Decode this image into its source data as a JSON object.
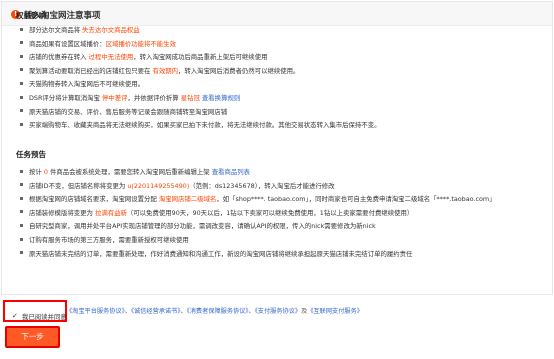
{
  "header": {
    "title": "转入淘宝网注意事项"
  },
  "sections": [
    {
      "title": "权益影响",
      "rows": [
        [
          {
            "t": "部分达尔文商品将 "
          },
          {
            "t": "失去达尔文商品权益",
            "c": "red"
          }
        ],
        [
          {
            "t": "商品如果有设置区域播价："
          },
          {
            "t": "区域播价功能将不能生效",
            "c": "red"
          }
        ],
        [
          {
            "t": "店铺的优惠券在转入 "
          },
          {
            "t": "过程中无法使用",
            "c": "red"
          },
          {
            "t": "，转入淘宝网成功后商品重新上架后可继续使用"
          }
        ],
        [
          {
            "t": "聚划算活动要取消已经出的店铺红包只要在 "
          },
          {
            "t": "有效期内",
            "c": "red"
          },
          {
            "t": "，转入淘宝网后消费者仍然可以继续使用。"
          }
        ],
        [
          {
            "t": "天猫购物券转入淘宝网后不可继续使用。"
          }
        ],
        [
          {
            "t": "DSR评分将计算取消淘宝 "
          },
          {
            "t": "停中差评",
            "c": "red"
          },
          {
            "t": "，并依据评价折算 "
          },
          {
            "t": "星钻冠",
            "c": "red"
          },
          {
            "t": " "
          },
          {
            "t": "查看换算规则",
            "c": "blue"
          }
        ],
        [
          {
            "t": "原天猫店铺的交易、评价、售后服务等记录会跟随商铺转至淘宝网店铺"
          }
        ],
        [
          {
            "t": "买家端购物车、收藏夹商品将无法继续购买，如果买家已拍下未付款，将无法继续付款。其他交易状态转入集市后保持不变。"
          }
        ]
      ]
    },
    {
      "title": "任务预告",
      "rows": [
        [
          {
            "t": "按计 "
          },
          {
            "t": "0",
            "c": "red"
          },
          {
            "t": " 件商品会被系统处理，需要您转入淘宝网后重新编辑上架 "
          },
          {
            "t": "查看商品列表",
            "c": "blue"
          }
        ],
        [
          {
            "t": "店铺ID不变，但店铺名称将变更为 "
          },
          {
            "t": "u(2201149255490)",
            "c": "red"
          },
          {
            "t": "（范例：ds12345678），转入淘宝后才能进行修改"
          }
        ],
        [
          {
            "t": "根据淘宝网的店铺域名要求，淘宝网设置分配 "
          },
          {
            "t": "淘宝网店铺二级域名",
            "c": "red"
          },
          {
            "t": "，如「shop****. taobao.com」，同时商家也可自主免费申请淘宝二级域名「****.taobao.com」"
          }
        ],
        [
          {
            "t": "店铺装修模版将变更为 "
          },
          {
            "t": "拉满有益新",
            "c": "red"
          },
          {
            "t": "（可以免费使用90天，90天以后，1钻以下卖家可以继续免费使用，1钻以上卖家需要付费继续使用）"
          }
        ],
        [
          {
            "t": "自研究型商家，调用并处平台API实现店铺管理的部分功能，需调改变容，请确认API的权限，传入的nick需要修改为新nick"
          }
        ],
        [
          {
            "t": "订购有服务市场的第三方服务，需要重新授权可继续使用"
          }
        ],
        [
          {
            "t": "原天猫店铺未完结的订单，需要重新处理，作好消费通知和沟通工作，新设的淘宝网店铺将继续承担起原天猫店铺未完结订单的履约责任"
          }
        ]
      ]
    }
  ],
  "footer": {
    "agree_label": "我已阅读并同意",
    "links_prefix": "《淘宝平台服务协议》、《诚信经营承诺书》、《消费者保障服务协议》、《支付服务协议》及《互联网支付服务》",
    "link_items": [
      "《淘宝平台服务协议》",
      "《诚信经营承诺书》",
      "《消费者保障服务协议》",
      "《支付服务协议》",
      "《互联网支付服务》"
    ],
    "link_seps": [
      "、",
      "、",
      "、",
      "及",
      ""
    ],
    "next_label": "下一步"
  }
}
